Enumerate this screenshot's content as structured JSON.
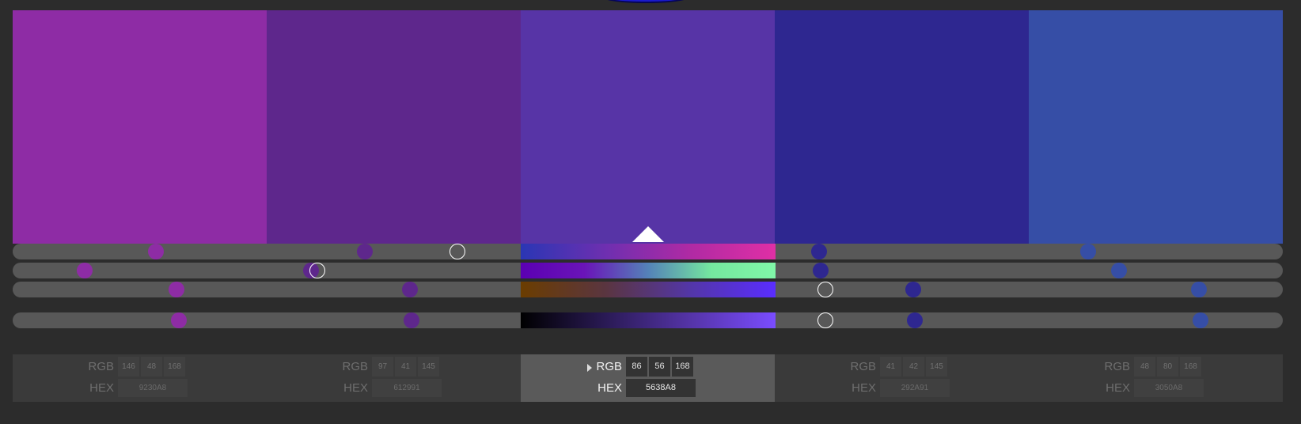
{
  "active_index": 2,
  "labels": {
    "rgb": "RGB",
    "hex": "HEX"
  },
  "swatches": [
    {
      "rgb": [
        "146",
        "48",
        "168"
      ],
      "hex": "9230A8",
      "color": "#8e2ca5"
    },
    {
      "rgb": [
        "97",
        "41",
        "145"
      ],
      "hex": "612991",
      "color": "#5e278c"
    },
    {
      "rgb": [
        "86",
        "56",
        "168"
      ],
      "hex": "5638A8",
      "color": "#5734a6"
    },
    {
      "rgb": [
        "41",
        "42",
        "145"
      ],
      "hex": "292A91",
      "color": "#2e2790"
    },
    {
      "rgb": [
        "48",
        "80",
        "168"
      ],
      "hex": "3050A8",
      "color": "#364ea6"
    }
  ],
  "slider_rows": [
    {
      "name": "hue",
      "gradient": [
        "#2a36b4",
        "#6e2fb0",
        "#b02aa4",
        "#e02fa5"
      ]
    },
    {
      "name": "saturation",
      "gradient": [
        "#5b00b3",
        "#6a14b8",
        "#5482b8",
        "#75e79f",
        "#80f7a8"
      ]
    },
    {
      "name": "luminance",
      "gradient": [
        "#6b3d00",
        "#5a3540",
        "#5336a8",
        "#5a2dff"
      ]
    },
    {
      "name": "brightness",
      "gradient": [
        "#000000",
        "#2a1a55",
        "#5534a8",
        "#7a4cff"
      ]
    }
  ],
  "dots": [
    [
      0.113,
      0.057,
      0.129,
      0.131
    ],
    [
      0.277,
      0.235,
      0.313,
      0.314
    ],
    [
      0.35,
      0.24,
      0.64,
      0.64
    ],
    [
      0.635,
      0.636,
      0.709,
      0.71
    ],
    [
      0.847,
      0.871,
      0.934,
      0.935
    ]
  ]
}
